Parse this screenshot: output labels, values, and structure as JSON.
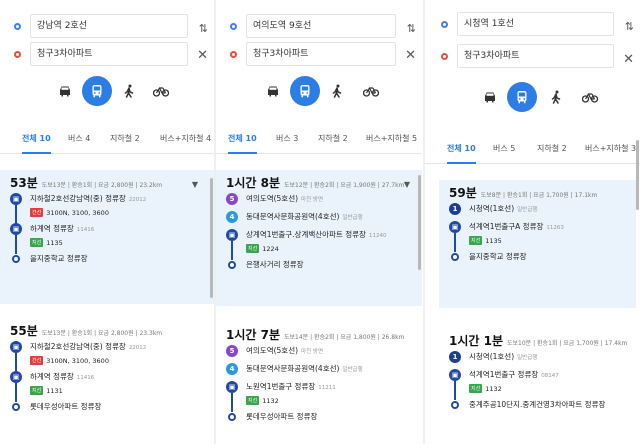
{
  "panels": [
    {
      "from": "강남역 2호선",
      "to": "청구3차아파트",
      "tabs": [
        "전체 10",
        "버스 4",
        "지하철 2",
        "버스+지하철 4"
      ],
      "routes": [
        {
          "time": "53분",
          "meta": "도보13분 | 환승1회 | 요금 2,800원 | 23.2km",
          "stops": [
            {
              "name": "지하철2호선강남역(중) 정류장",
              "sub": "22012",
              "badge": "간선",
              "lines": "3100N, 3100, 3600"
            },
            {
              "name": "하계역 정류장",
              "sub": "11416",
              "badge": "지선",
              "lines": "1135"
            },
            {
              "name": "을지중학교 정류장",
              "sub": "",
              "badge": "",
              "lines": ""
            }
          ]
        },
        {
          "time": "55분",
          "meta": "도보13분 | 환승1회 | 요금 2,800원 | 23.3km",
          "stops": [
            {
              "name": "지하철2호선강남역(중) 정류장",
              "sub": "22012",
              "badge": "간선",
              "lines": "3100N, 3100, 3600"
            },
            {
              "name": "하계역 정류장",
              "sub": "11416",
              "badge": "지선",
              "lines": "1131"
            },
            {
              "name": "롯데우성아파트 정류장",
              "sub": "",
              "badge": "",
              "lines": ""
            }
          ]
        }
      ]
    },
    {
      "from": "여의도역 9호선",
      "to": "청구3차아파트",
      "tabs": [
        "전체 10",
        "버스 3",
        "지하철 2",
        "버스+지하철 5"
      ],
      "routes": [
        {
          "time": "1시간 8분",
          "meta": "도보12분 | 환승2회 | 요금 1,900원 | 27.7km",
          "stops": [
            {
              "name": "여의도역(5호선)",
              "sub": "마천 방면",
              "badge": "",
              "lines": "",
              "line": "5"
            },
            {
              "name": "동대문역사문화공원역(4호선)",
              "sub": "일반급행",
              "badge": "",
              "lines": "",
              "line": "4"
            },
            {
              "name": "상계역1번출구.상계백산아파트 정류장",
              "sub": "11240",
              "badge": "지선",
              "lines": "1224"
            },
            {
              "name": "은행사거리 정류장",
              "sub": "",
              "badge": "",
              "lines": ""
            }
          ]
        },
        {
          "time": "1시간 7분",
          "meta": "도보14분 | 환승2회 | 요금 1,800원 | 26.8km",
          "stops": [
            {
              "name": "여의도역(5호선)",
              "sub": "마천 방면",
              "badge": "",
              "lines": "",
              "line": "5"
            },
            {
              "name": "동대문역사문화공원역(4호선)",
              "sub": "일반급행",
              "badge": "",
              "lines": "",
              "line": "4"
            },
            {
              "name": "노원역1번출구 정류장",
              "sub": "11211",
              "badge": "지선",
              "lines": "1132"
            },
            {
              "name": "롯데우성아파트 정류장",
              "sub": "",
              "badge": "",
              "lines": ""
            }
          ]
        }
      ]
    },
    {
      "from": "시청역 1호선",
      "to": "청구3차아파트",
      "tabs": [
        "전체 10",
        "버스 5",
        "지하철 2",
        "버스+지하철 3"
      ],
      "routes": [
        {
          "time": "59분",
          "meta": "도보8분 | 환승1회 | 요금 1,700원 | 17.1km",
          "stops": [
            {
              "name": "시청역(1호선)",
              "sub": "일반급행",
              "badge": "",
              "lines": "",
              "line": "1"
            },
            {
              "name": "석계역1번출구A 정류장",
              "sub": "11263",
              "badge": "지선",
              "lines": "1135"
            },
            {
              "name": "을지중학교 정류장",
              "sub": "",
              "badge": "",
              "lines": ""
            }
          ]
        },
        {
          "time": "1시간 1분",
          "meta": "도보10분 | 환승1회 | 요금 1,700원 | 17.4km",
          "stops": [
            {
              "name": "시청역(1호선)",
              "sub": "일반급행",
              "badge": "",
              "lines": "",
              "line": "1"
            },
            {
              "name": "석계역1번출구 정류장",
              "sub": "08147",
              "badge": "지선",
              "lines": "1132"
            },
            {
              "name": "중계주공10단지.중계건영3차아파트 정류장",
              "sub": "",
              "badge": "",
              "lines": ""
            }
          ]
        }
      ]
    }
  ],
  "colors": {
    "accent": "#2c7de6",
    "bus": "#1f4aa8",
    "line5": "#8a46c8",
    "line4": "#2b9bd8",
    "line1": "#1e3f8f",
    "trunk": "#e23c3c",
    "branch": "#3aa64c"
  },
  "icons": {
    "car": "car-icon",
    "bus": "bus-icon",
    "walk": "walk-icon",
    "bike": "bike-icon",
    "swap": "swap-icon",
    "clear": "close-icon"
  }
}
